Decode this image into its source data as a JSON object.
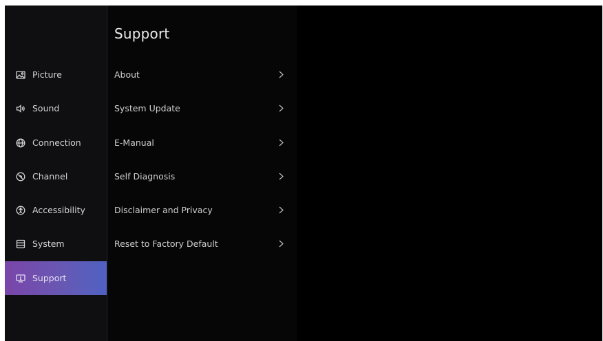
{
  "sidebar": {
    "items": [
      {
        "label": "Picture",
        "icon": "picture-icon"
      },
      {
        "label": "Sound",
        "icon": "sound-icon"
      },
      {
        "label": "Connection",
        "icon": "globe-icon"
      },
      {
        "label": "Channel",
        "icon": "channel-icon"
      },
      {
        "label": "Accessibility",
        "icon": "accessibility-icon"
      },
      {
        "label": "System",
        "icon": "system-icon"
      },
      {
        "label": "Support",
        "icon": "support-icon",
        "selected": true
      }
    ]
  },
  "panel": {
    "title": "Support",
    "items": [
      {
        "label": "About"
      },
      {
        "label": "System Update"
      },
      {
        "label": "E-Manual"
      },
      {
        "label": "Self Diagnosis"
      },
      {
        "label": "Disclaimer and Privacy"
      },
      {
        "label": "Reset to Factory Default"
      }
    ]
  },
  "colors": {
    "background": "#000000",
    "sidebar": "#0f0f11",
    "selected_gradient_start": "#7a45aa",
    "selected_gradient_end": "#4f62c2",
    "text": "#d4d4d4"
  }
}
